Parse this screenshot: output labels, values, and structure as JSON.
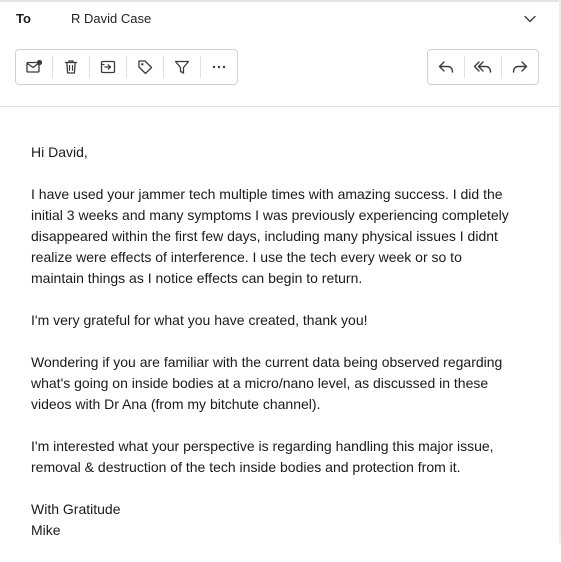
{
  "header": {
    "to_label": "To",
    "recipient": "R David Case",
    "expand_icon": "chevron-down-icon"
  },
  "toolbar": {
    "left": [
      {
        "name": "mark-unread",
        "icon": "envelope-dot-icon"
      },
      {
        "name": "delete",
        "icon": "trash-icon"
      },
      {
        "name": "move",
        "icon": "move-to-folder-icon"
      },
      {
        "name": "tag",
        "icon": "tag-icon"
      },
      {
        "name": "filter",
        "icon": "filter-icon"
      },
      {
        "name": "more",
        "icon": "more-horizontal-icon"
      }
    ],
    "right": [
      {
        "name": "reply",
        "icon": "reply-icon"
      },
      {
        "name": "reply-all",
        "icon": "reply-all-icon"
      },
      {
        "name": "forward",
        "icon": "forward-icon"
      }
    ]
  },
  "message": {
    "greeting": "Hi David,",
    "paragraph1": [
      "I have used your jammer tech multiple times with amazing success. I did the",
      "initial 3 weeks and many symptoms I was previously experiencing completely",
      "disappeared within the first few days, including many physical issues I didnt",
      "realize were effects of interference. I use the tech every week or so to",
      "maintain things as I notice effects can begin to return."
    ],
    "paragraph2": "I'm very grateful for what you have created, thank you!",
    "paragraph3": [
      "Wondering if you are familiar with the current data being observed regarding",
      "what's going on inside bodies at a micro/nano level, as discussed in these",
      "videos with Dr Ana (from my bitchute channel)."
    ],
    "paragraph4": [
      "I'm interested what your perspective is regarding handling this major issue,",
      "removal & destruction of the tech inside bodies and protection from it."
    ],
    "closing": "With Gratitude",
    "signature": "Mike"
  },
  "colors": {
    "icon": "#3a3a3a",
    "border": "#d2d2d2",
    "text": "#1a1a1a"
  }
}
